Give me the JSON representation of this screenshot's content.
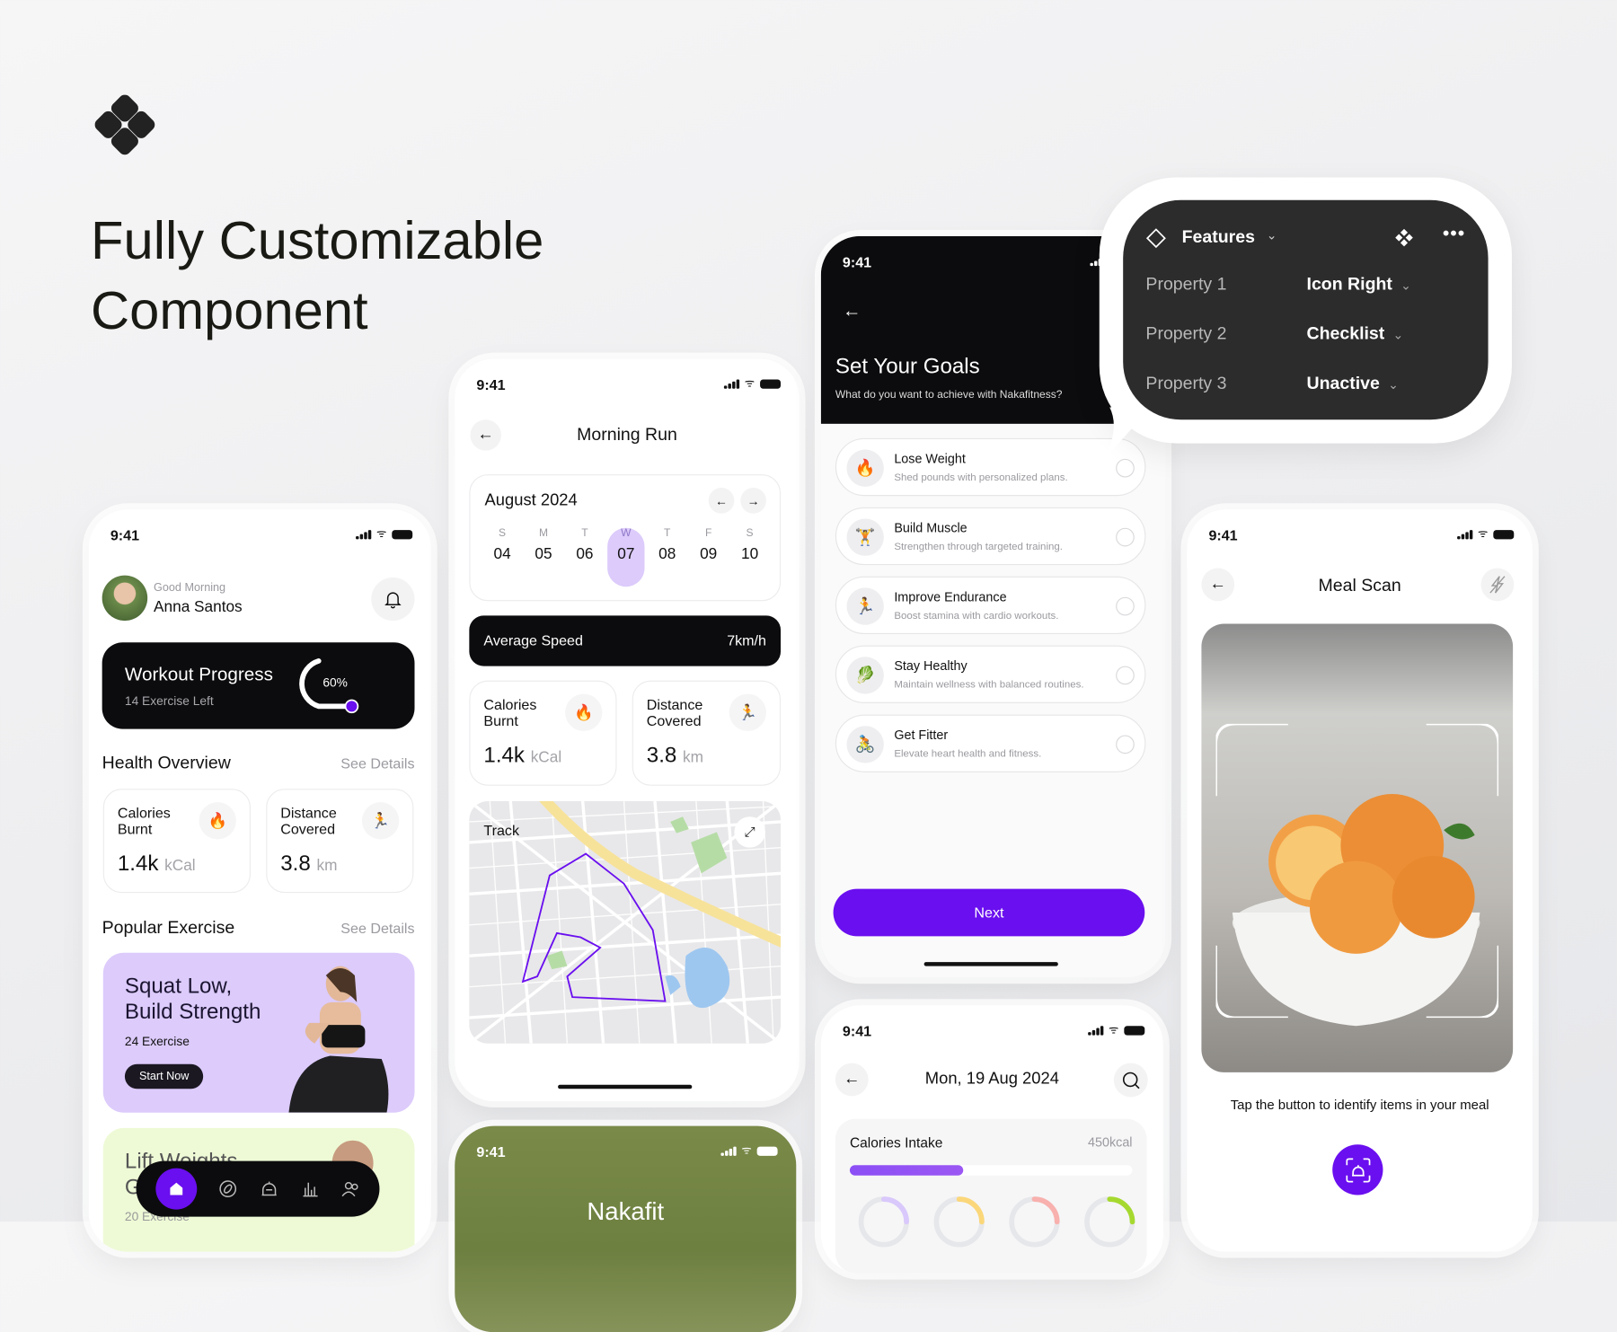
{
  "hero": {
    "title_line1": "Fully Customizable",
    "title_line2": "Component"
  },
  "status_time": "9:41",
  "home": {
    "greeting": "Good Morning",
    "user_name": "Anna Santos",
    "workout": {
      "title": "Workout Progress",
      "subtitle": "14 Exercise Left",
      "percent_label": "60%",
      "progress": 0.6
    },
    "health_title": "Health Overview",
    "see_details": "See Details",
    "stats": [
      {
        "label1": "Calories",
        "label2": "Burnt",
        "value": "1.4k",
        "unit": "kCal",
        "icon": "fire-icon"
      },
      {
        "label1": "Distance",
        "label2": "Covered",
        "value": "3.8",
        "unit": "km",
        "icon": "runner-icon"
      }
    ],
    "popular_title": "Popular Exercise",
    "exercises": [
      {
        "title1": "Squat Low,",
        "title2": "Build Strength",
        "count": "24 Exercise",
        "cta": "Start Now"
      },
      {
        "title1": "Lift Weights,",
        "title2": "G",
        "count": "20 Exercise"
      }
    ],
    "nav": [
      "home-icon",
      "explore-icon",
      "workout-icon",
      "stats-icon",
      "community-icon"
    ]
  },
  "run": {
    "title": "Morning Run",
    "month": "August 2024",
    "days": [
      {
        "l": "S",
        "n": "04"
      },
      {
        "l": "M",
        "n": "05"
      },
      {
        "l": "T",
        "n": "06"
      },
      {
        "l": "W",
        "n": "07"
      },
      {
        "l": "T",
        "n": "08"
      },
      {
        "l": "F",
        "n": "09"
      },
      {
        "l": "S",
        "n": "10"
      }
    ],
    "selected_day": "07",
    "speed_label": "Average Speed",
    "speed_value": "7km/h",
    "stats": [
      {
        "label1": "Calories",
        "label2": "Burnt",
        "value": "1.4k",
        "unit": "kCal"
      },
      {
        "label1": "Distance",
        "label2": "Covered",
        "value": "3.8",
        "unit": "km"
      }
    ],
    "track_label": "Track"
  },
  "splash": {
    "brand": "Nakafit"
  },
  "goals": {
    "title": "Set Your Goals",
    "subtitle": "What do you want to achieve with Nakafitness?",
    "items": [
      {
        "title": "Lose Weight",
        "desc": "Shed pounds with personalized plans.",
        "emoji": "🔥"
      },
      {
        "title": "Build Muscle",
        "desc": "Strengthen through targeted training.",
        "emoji": "🏋️"
      },
      {
        "title": "Improve Endurance",
        "desc": "Boost stamina with cardio workouts.",
        "emoji": "🏃"
      },
      {
        "title": "Stay Healthy",
        "desc": "Maintain wellness with balanced routines.",
        "emoji": "🥬"
      },
      {
        "title": "Get Fitter",
        "desc": "Elevate heart health and fitness.",
        "emoji": "🚴"
      }
    ],
    "next": "Next"
  },
  "features": {
    "title": "Features",
    "rows": [
      {
        "name": "Property 1",
        "value": "Icon Right"
      },
      {
        "name": "Property 2",
        "value": "Checklist"
      },
      {
        "name": "Property 3",
        "value": "Unactive"
      }
    ]
  },
  "nutrition": {
    "date": "Mon, 19 Aug 2024",
    "intake_label": "Calories Intake",
    "intake_value": "450kcal",
    "intake_progress": 0.4,
    "ring_colors": [
      "#d9c8fb",
      "#fbd77a",
      "#f8b1ae",
      "#a6d92f"
    ]
  },
  "meal": {
    "title": "Meal Scan",
    "hint": "Tap the button to identify items in your meal"
  },
  "colors": {
    "accent": "#6a0fef",
    "dark": "#0c0c0e",
    "lavender": "#dccbfb",
    "lime": "#eefad6"
  }
}
